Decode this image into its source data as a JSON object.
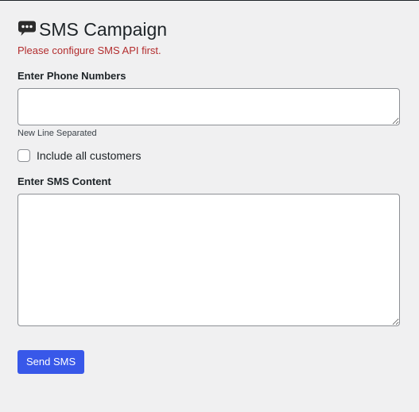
{
  "header": {
    "icon": "speech-bubble-icon",
    "title": "SMS Campaign"
  },
  "notice": {
    "error_text": "Please configure SMS API first.",
    "error_color": "#b32d2e"
  },
  "phone_numbers": {
    "label": "Enter Phone Numbers",
    "value": "",
    "hint": "New Line Separated"
  },
  "include_all": {
    "label": "Include all customers",
    "checked": false
  },
  "sms_content": {
    "label": "Enter SMS Content",
    "value": ""
  },
  "actions": {
    "send_label": "Send SMS",
    "accent_color": "#3858e9"
  },
  "colors": {
    "background": "#f0f0f1",
    "text": "#1d2327",
    "border": "#8c8f94"
  }
}
